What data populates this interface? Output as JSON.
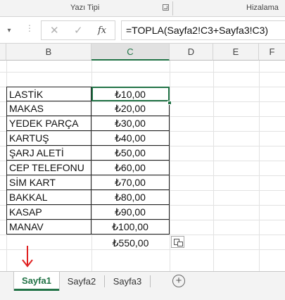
{
  "ribbon": {
    "font_group_label": "Yazı Tipi",
    "alignment_group_label": "Hizalama"
  },
  "formula_bar": {
    "formula": "=TOPLA(Sayfa2!C3+Sayfa3!C3)",
    "cancel_glyph": "✕",
    "enter_glyph": "✓",
    "fx_glyph": "fx",
    "namebox_drop_glyph": "▾"
  },
  "columns": [
    "B",
    "C",
    "D",
    "E",
    "F"
  ],
  "selected_column": "C",
  "rows": [
    {
      "name": "LASTİK",
      "price": "₺10,00"
    },
    {
      "name": "MAKAS",
      "price": "₺20,00"
    },
    {
      "name": "YEDEK PARÇA",
      "price": "₺30,00"
    },
    {
      "name": "KARTUŞ",
      "price": "₺40,00"
    },
    {
      "name": "ŞARJ ALETİ",
      "price": "₺50,00"
    },
    {
      "name": "CEP TELEFONU",
      "price": "₺60,00"
    },
    {
      "name": "SİM KART",
      "price": "₺70,00"
    },
    {
      "name": "BAKKAL",
      "price": "₺80,00"
    },
    {
      "name": "KASAP",
      "price": "₺90,00"
    },
    {
      "name": "MANAV",
      "price": "₺100,00"
    }
  ],
  "total": "₺550,00",
  "sheets": {
    "tabs": [
      "Sayfa1",
      "Sayfa2",
      "Sayfa3"
    ],
    "active": "Sayfa1",
    "add_glyph": "+"
  },
  "colors": {
    "excel_green": "#217346",
    "arrow_red": "#e02020"
  },
  "icons": {
    "arrow": "down-arrow-icon",
    "paste_options": "paste-options-icon",
    "add_sheet": "plus-circle-icon"
  }
}
